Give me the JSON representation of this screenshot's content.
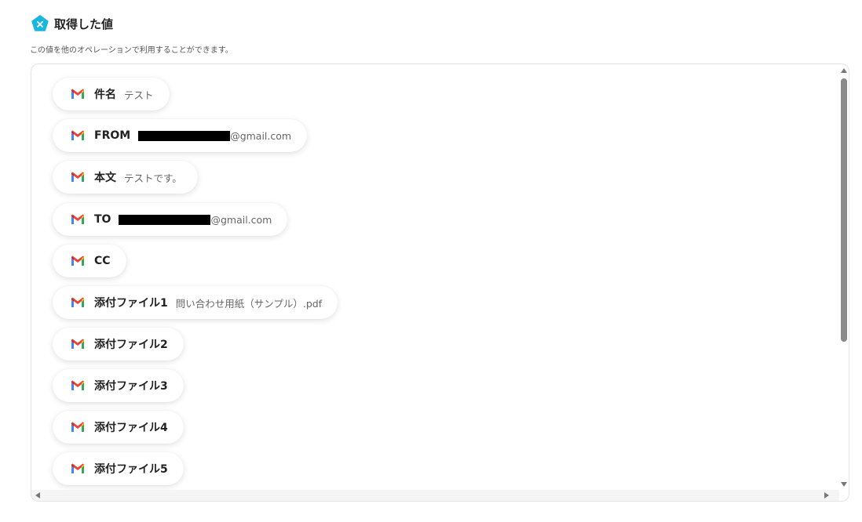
{
  "header": {
    "title": "取得した値",
    "subtitle": "この値を他のオペレーションで利用することができます。",
    "icon": "pentagon-x-icon",
    "icon_color": "#18b6e0"
  },
  "fields": [
    {
      "label": "件名",
      "value": "テスト",
      "icon": "gmail-icon"
    },
    {
      "label": "FROM",
      "value": "@gmail.com",
      "redacted": true,
      "icon": "gmail-icon"
    },
    {
      "label": "本文",
      "value": "テストです。",
      "icon": "gmail-icon"
    },
    {
      "label": "TO",
      "value": "@gmail.com",
      "redacted": true,
      "icon": "gmail-icon"
    },
    {
      "label": "CC",
      "value": "",
      "icon": "gmail-icon"
    },
    {
      "label": "添付ファイル1",
      "value": "問い合わせ用紙（サンプル）.pdf",
      "icon": "gmail-icon"
    },
    {
      "label": "添付ファイル2",
      "value": "",
      "icon": "gmail-icon"
    },
    {
      "label": "添付ファイル3",
      "value": "",
      "icon": "gmail-icon"
    },
    {
      "label": "添付ファイル4",
      "value": "",
      "icon": "gmail-icon"
    },
    {
      "label": "添付ファイル5",
      "value": "",
      "icon": "gmail-icon"
    }
  ]
}
